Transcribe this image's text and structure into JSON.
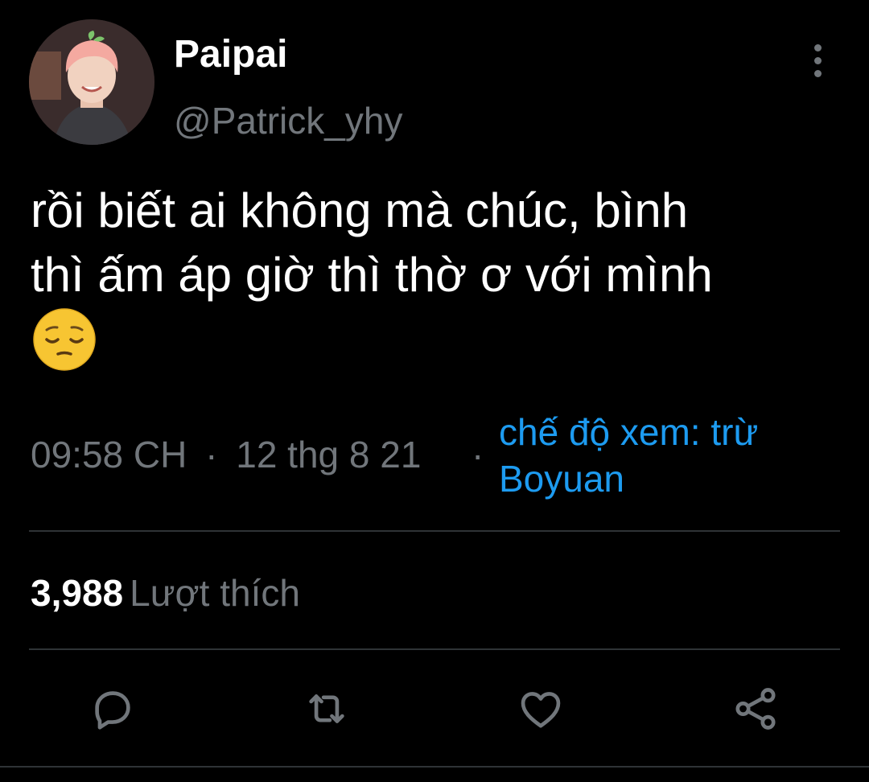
{
  "tweet": {
    "author": {
      "display_name": "Paipai",
      "handle": "@Patrick_yhy",
      "avatar_icon": "profile-photo"
    },
    "text": "rồi biết ai không mà chúc, bình\nthì ấm áp giờ thì thờ ơ với mình",
    "emoji": "pensive-face",
    "time": "09:58 CH",
    "separator": "·",
    "date": "12 thg 8 21",
    "view_mode": "chế độ xem: trừ Boyuan",
    "likes_count": "3,988",
    "likes_label": "Lượt thích"
  },
  "actions": [
    {
      "name": "reply",
      "icon": "comment-icon"
    },
    {
      "name": "retweet",
      "icon": "retweet-icon"
    },
    {
      "name": "like",
      "icon": "heart-icon"
    },
    {
      "name": "share",
      "icon": "share-icon"
    }
  ],
  "colors": {
    "background": "#000000",
    "text_primary": "#ffffff",
    "text_secondary": "#71767b",
    "accent": "#1d9bf0",
    "divider": "#2f3336"
  }
}
